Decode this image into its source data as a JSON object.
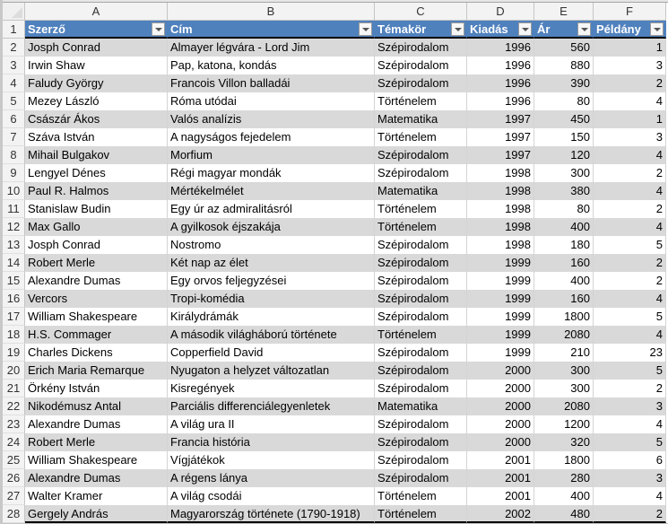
{
  "columns": [
    "A",
    "B",
    "C",
    "D",
    "E",
    "F"
  ],
  "headers": [
    "Szerző",
    "Cím",
    "Témakör",
    "Kiadás",
    "Ár",
    "Példány"
  ],
  "rows": [
    [
      "Josph Conrad",
      "Almayer légvára - Lord Jim",
      "Szépirodalom",
      "1996",
      "560",
      "1"
    ],
    [
      "Irwin Shaw",
      "Pap, katona, kondás",
      "Szépirodalom",
      "1996",
      "880",
      "3"
    ],
    [
      "Faludy György",
      "Francois Villon balladái",
      "Szépirodalom",
      "1996",
      "390",
      "2"
    ],
    [
      "Mezey László",
      "Róma utódai",
      "Történelem",
      "1996",
      "80",
      "4"
    ],
    [
      "Császár Ákos",
      "Valós analízis",
      "Matematika",
      "1997",
      "450",
      "1"
    ],
    [
      "Száva István",
      "A nagyságos fejedelem",
      "Történelem",
      "1997",
      "150",
      "3"
    ],
    [
      "Mihail Bulgakov",
      "Morfium",
      "Szépirodalom",
      "1997",
      "120",
      "4"
    ],
    [
      "Lengyel Dénes",
      "Régi magyar mondák",
      "Szépirodalom",
      "1998",
      "300",
      "2"
    ],
    [
      "Paul R. Halmos",
      "Mértékelmélet",
      "Matematika",
      "1998",
      "380",
      "4"
    ],
    [
      "Stanislaw Budin",
      "Egy úr az admiralitásról",
      "Történelem",
      "1998",
      "80",
      "2"
    ],
    [
      "Max Gallo",
      "A gyilkosok éjszakája",
      "Történelem",
      "1998",
      "400",
      "4"
    ],
    [
      "Josph Conrad",
      "Nostromo",
      "Szépirodalom",
      "1998",
      "180",
      "5"
    ],
    [
      "Robert Merle",
      "Két nap az élet",
      "Szépirodalom",
      "1999",
      "160",
      "2"
    ],
    [
      "Alexandre Dumas",
      "Egy orvos feljegyzései",
      "Szépirodalom",
      "1999",
      "400",
      "2"
    ],
    [
      "Vercors",
      "Tropi-komédia",
      "Szépirodalom",
      "1999",
      "160",
      "4"
    ],
    [
      "William Shakespeare",
      "Királydrámák",
      "Szépirodalom",
      "1999",
      "1800",
      "5"
    ],
    [
      "H.S. Commager",
      "A második világháború története",
      "Történelem",
      "1999",
      "2080",
      "4"
    ],
    [
      "Charles Dickens",
      "Copperfield David",
      "Szépirodalom",
      "1999",
      "210",
      "23"
    ],
    [
      "Erich Maria Remarque",
      "Nyugaton a helyzet változatlan",
      "Szépirodalom",
      "2000",
      "300",
      "5"
    ],
    [
      "Örkény István",
      "Kisregények",
      "Szépirodalom",
      "2000",
      "300",
      "2"
    ],
    [
      "Nikodémusz Antal",
      "Parciális differenciálegyenletek",
      "Matematika",
      "2000",
      "2080",
      "3"
    ],
    [
      "Alexandre Dumas",
      "A világ ura II",
      "Szépirodalom",
      "2000",
      "1200",
      "4"
    ],
    [
      "Robert Merle",
      "Francia história",
      "Szépirodalom",
      "2000",
      "320",
      "5"
    ],
    [
      "William Shakespeare",
      "Vígjátékok",
      "Szépirodalom",
      "2001",
      "1800",
      "6"
    ],
    [
      "Alexandre Dumas",
      "A régens lánya",
      "Szépirodalom",
      "2001",
      "280",
      "3"
    ],
    [
      "Walter Kramer",
      "A világ csodái",
      "Történelem",
      "2001",
      "400",
      "4"
    ],
    [
      "Gergely András",
      "Magyarország története (1790-1918)",
      "Történelem",
      "2002",
      "480",
      "2"
    ]
  ],
  "colors": {
    "header_bg": "#4f81bd",
    "band_bg": "#d9d9d9"
  }
}
